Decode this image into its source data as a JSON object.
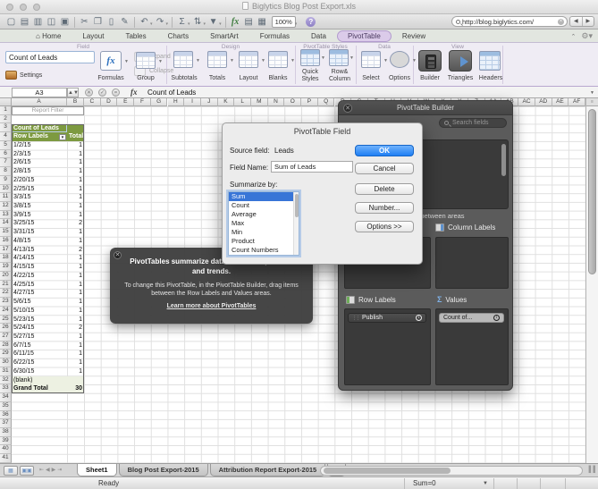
{
  "window": {
    "title": "Biglytics Blog Post Export.xls"
  },
  "toolbar": {
    "icons": [
      {
        "name": "new-document-icon",
        "glyph": "▢"
      },
      {
        "name": "open-workbook-icon",
        "glyph": "▤"
      },
      {
        "name": "templates-icon",
        "glyph": "▥"
      },
      {
        "name": "save-icon",
        "glyph": "◫"
      },
      {
        "name": "print-icon",
        "glyph": "▣"
      },
      {
        "sep": true
      },
      {
        "name": "cut-icon",
        "glyph": "✂"
      },
      {
        "name": "copy-icon",
        "glyph": "❐"
      },
      {
        "name": "paste-icon",
        "glyph": "▯"
      },
      {
        "name": "format-painter-icon",
        "glyph": "✎"
      },
      {
        "sep": true
      },
      {
        "name": "undo-icon",
        "glyph": "↶",
        "dropdown": true
      },
      {
        "name": "redo-icon",
        "glyph": "↷",
        "dropdown": true
      },
      {
        "sep": true
      },
      {
        "name": "autosum-icon",
        "glyph": "Σ",
        "dropdown": true
      },
      {
        "name": "sort-icon",
        "glyph": "⇅",
        "dropdown": true
      },
      {
        "name": "filter-icon",
        "glyph": "▼",
        "dropdown": true
      },
      {
        "sep": true
      },
      {
        "name": "insert-function-icon",
        "glyph": "fx"
      },
      {
        "name": "form-icon",
        "glyph": "▤"
      },
      {
        "name": "chart-icon",
        "glyph": "▦"
      }
    ],
    "zoom_value": "100%",
    "help_label": "?",
    "search_value": "http://blog.biglytics.com/"
  },
  "tabs": {
    "items": [
      "Home",
      "Layout",
      "Tables",
      "Charts",
      "SmartArt",
      "Formulas",
      "Data",
      "PivotTable",
      "Review"
    ],
    "active": "PivotTable"
  },
  "ribbon": {
    "field": {
      "label": "Field",
      "field_value": "Count of Leads",
      "settings": "Settings",
      "formulas": "Formulas",
      "expand": "Expand",
      "collapse": "Collapse",
      "group": "Group"
    },
    "design": {
      "label": "Design",
      "subtotals": "Subtotals",
      "totals": "Totals",
      "layout": "Layout",
      "blanks": "Blanks"
    },
    "styles": {
      "label": "PivotTable Styles",
      "quick_styles": "Quick Styles",
      "row_column": "Row& Column"
    },
    "data": {
      "label": "Data",
      "select": "Select",
      "options": "Options"
    },
    "view": {
      "label": "View",
      "builder": "Builder",
      "triangles": "Triangles",
      "headers": "Headers"
    }
  },
  "formula_bar": {
    "cell_ref": "A3",
    "content": "Count of Leads"
  },
  "spreadsheet": {
    "columns": [
      "A",
      "B",
      "C",
      "D",
      "E",
      "F",
      "G",
      "H",
      "I",
      "J",
      "K",
      "L",
      "M",
      "N",
      "O",
      "P",
      "Q",
      "R",
      "S",
      "T",
      "U",
      "V",
      "W",
      "X",
      "Y",
      "Z",
      "AA",
      "AB",
      "AC",
      "AD",
      "AE",
      "AF"
    ],
    "row_count": 41,
    "report_filter_label": "Report Filter",
    "pivot": {
      "title": "Count of Leads",
      "row_labels_header": "Row Labels",
      "total_header": "Total",
      "rows": [
        [
          "1/2/15",
          1
        ],
        [
          "2/3/15",
          1
        ],
        [
          "2/6/15",
          1
        ],
        [
          "2/8/15",
          1
        ],
        [
          "2/20/15",
          1
        ],
        [
          "2/25/15",
          1
        ],
        [
          "3/3/15",
          1
        ],
        [
          "3/8/15",
          1
        ],
        [
          "3/9/15",
          1
        ],
        [
          "3/25/15",
          2
        ],
        [
          "3/31/15",
          1
        ],
        [
          "4/8/15",
          1
        ],
        [
          "4/13/15",
          2
        ],
        [
          "4/14/15",
          1
        ],
        [
          "4/15/15",
          1
        ],
        [
          "4/22/15",
          1
        ],
        [
          "4/25/15",
          1
        ],
        [
          "4/27/15",
          1
        ],
        [
          "5/6/15",
          1
        ],
        [
          "5/10/15",
          1
        ],
        [
          "5/23/15",
          1
        ],
        [
          "5/24/15",
          2
        ],
        [
          "5/27/15",
          1
        ],
        [
          "6/7/15",
          1
        ],
        [
          "6/11/15",
          1
        ],
        [
          "6/22/15",
          1
        ],
        [
          "6/30/15",
          1
        ]
      ],
      "blank_label": "(blank)",
      "grand_total_label": "Grand Total",
      "grand_total_value": 30
    }
  },
  "dialog": {
    "title": "PivotTable Field",
    "source_field_label": "Source field:",
    "source_field_value": "Leads",
    "field_name_label": "Field Name:",
    "field_name_value": "Sum of Leads",
    "summarize_label": "Summarize by:",
    "summarize_options": [
      "Sum",
      "Count",
      "Average",
      "Max",
      "Min",
      "Product",
      "Count Numbers"
    ],
    "selected_option": "Sum",
    "buttons": {
      "ok": "OK",
      "cancel": "Cancel",
      "delete": "Delete",
      "number": "Number...",
      "options": "Options >>"
    }
  },
  "builder": {
    "title": "PivotTable Builder",
    "search_placeholder": "Search fields",
    "drag_hint": "Drag fields between areas",
    "column_labels": "Column Labels",
    "row_labels": "Row Labels",
    "values_label": "Values",
    "row_pills": [
      "Publish"
    ],
    "value_pills": [
      "Count of..."
    ]
  },
  "tooltip": {
    "heading": "PivotTables summarize data and reveal patterns and trends.",
    "body": "To change this PivotTable, in the PivotTable Builder, drag items between the Row Labels and Values areas.",
    "link": "Learn more about PivotTables"
  },
  "sheet_tabs": {
    "items": [
      "Sheet1",
      "Blog Post Export-2015",
      "Attribution Report Export-2015"
    ],
    "active": "Sheet1",
    "add_label": "+"
  },
  "status_bar": {
    "mode": "Ready",
    "aggregate": "Sum=0"
  },
  "colors": {
    "accent_green": "#7d9a40",
    "tab_accent": "#dbcbe9",
    "ok_blue": "#1f7ff4",
    "select_blue": "#3875d7"
  }
}
